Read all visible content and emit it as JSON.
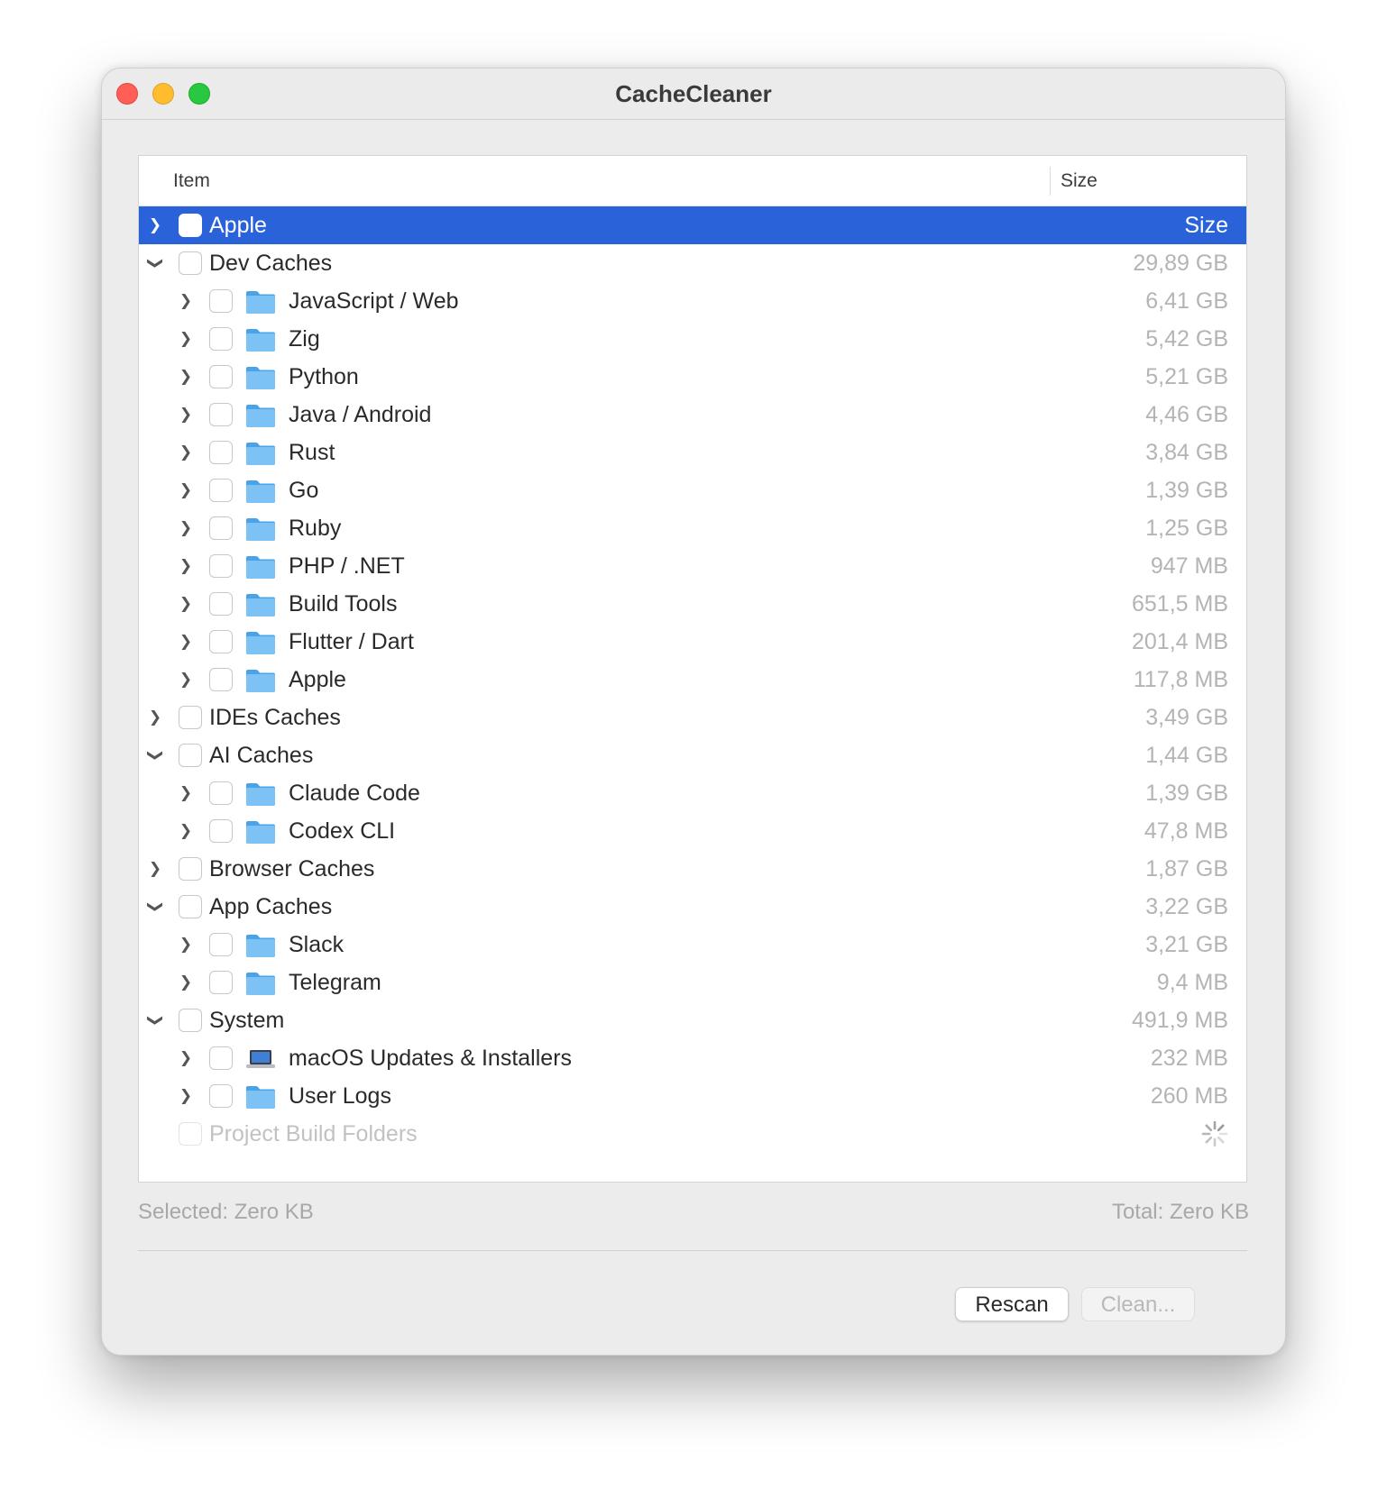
{
  "window": {
    "title": "CacheCleaner"
  },
  "table": {
    "columns": {
      "item": "Item",
      "size": "Size"
    },
    "rows": [
      {
        "label": "Apple",
        "size": "Size",
        "level": 0,
        "expandable": true,
        "expanded": false,
        "selected": true,
        "icon": "none"
      },
      {
        "label": "Dev Caches",
        "size": "29,89 GB",
        "level": 0,
        "expandable": true,
        "expanded": true,
        "icon": "none"
      },
      {
        "label": "JavaScript / Web",
        "size": "6,41 GB",
        "level": 1,
        "expandable": true,
        "expanded": false,
        "icon": "folder"
      },
      {
        "label": "Zig",
        "size": "5,42 GB",
        "level": 1,
        "expandable": true,
        "expanded": false,
        "icon": "folder"
      },
      {
        "label": "Python",
        "size": "5,21 GB",
        "level": 1,
        "expandable": true,
        "expanded": false,
        "icon": "folder"
      },
      {
        "label": "Java / Android",
        "size": "4,46 GB",
        "level": 1,
        "expandable": true,
        "expanded": false,
        "icon": "folder"
      },
      {
        "label": "Rust",
        "size": "3,84 GB",
        "level": 1,
        "expandable": true,
        "expanded": false,
        "icon": "folder"
      },
      {
        "label": "Go",
        "size": "1,39 GB",
        "level": 1,
        "expandable": true,
        "expanded": false,
        "icon": "folder"
      },
      {
        "label": "Ruby",
        "size": "1,25 GB",
        "level": 1,
        "expandable": true,
        "expanded": false,
        "icon": "folder"
      },
      {
        "label": "PHP / .NET",
        "size": "947 MB",
        "level": 1,
        "expandable": true,
        "expanded": false,
        "icon": "folder"
      },
      {
        "label": "Build Tools",
        "size": "651,5 MB",
        "level": 1,
        "expandable": true,
        "expanded": false,
        "icon": "folder"
      },
      {
        "label": "Flutter / Dart",
        "size": "201,4 MB",
        "level": 1,
        "expandable": true,
        "expanded": false,
        "icon": "folder"
      },
      {
        "label": "Apple",
        "size": "117,8 MB",
        "level": 1,
        "expandable": true,
        "expanded": false,
        "icon": "folder"
      },
      {
        "label": "IDEs Caches",
        "size": "3,49 GB",
        "level": 0,
        "expandable": true,
        "expanded": false,
        "icon": "none"
      },
      {
        "label": "AI Caches",
        "size": "1,44 GB",
        "level": 0,
        "expandable": true,
        "expanded": true,
        "icon": "none"
      },
      {
        "label": "Claude Code",
        "size": "1,39 GB",
        "level": 1,
        "expandable": true,
        "expanded": false,
        "icon": "folder"
      },
      {
        "label": "Codex CLI",
        "size": "47,8 MB",
        "level": 1,
        "expandable": true,
        "expanded": false,
        "icon": "folder"
      },
      {
        "label": "Browser Caches",
        "size": "1,87 GB",
        "level": 0,
        "expandable": true,
        "expanded": false,
        "icon": "none"
      },
      {
        "label": "App Caches",
        "size": "3,22 GB",
        "level": 0,
        "expandable": true,
        "expanded": true,
        "icon": "none"
      },
      {
        "label": "Slack",
        "size": "3,21 GB",
        "level": 1,
        "expandable": true,
        "expanded": false,
        "icon": "folder"
      },
      {
        "label": "Telegram",
        "size": "9,4 MB",
        "level": 1,
        "expandable": true,
        "expanded": false,
        "icon": "folder"
      },
      {
        "label": "System",
        "size": "491,9 MB",
        "level": 0,
        "expandable": true,
        "expanded": true,
        "icon": "none"
      },
      {
        "label": "macOS Updates & Installers",
        "size": "232 MB",
        "level": 1,
        "expandable": true,
        "expanded": false,
        "icon": "laptop"
      },
      {
        "label": "User Logs",
        "size": "260 MB",
        "level": 1,
        "expandable": true,
        "expanded": false,
        "icon": "folder"
      },
      {
        "label": "Project Build Folders",
        "size": "",
        "level": 0,
        "expandable": false,
        "expanded": false,
        "disabled": true,
        "loading": true,
        "icon": "none"
      }
    ]
  },
  "footer": {
    "selected": "Selected: Zero KB",
    "total": "Total: Zero KB"
  },
  "buttons": {
    "rescan": "Rescan",
    "clean": "Clean..."
  },
  "colors": {
    "selection": "#2962d9",
    "folder": "#7cc2f4",
    "close": "#ff5f57",
    "minimize": "#febc2e",
    "maximize": "#28c840"
  }
}
